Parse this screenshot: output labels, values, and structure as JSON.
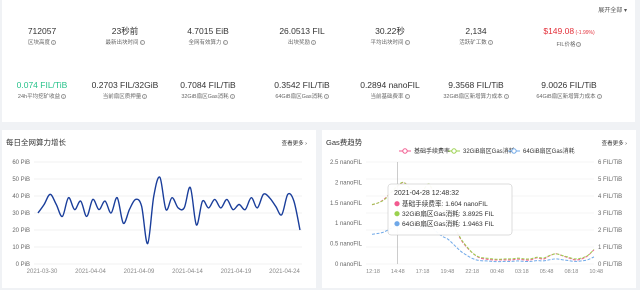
{
  "expand_label": "展开全部",
  "row1": [
    {
      "value": "712057",
      "label": "区块高度"
    },
    {
      "value": "23秒前",
      "label": "最新出块时间"
    },
    {
      "value": "4.7015 EiB",
      "label": "全网有效算力"
    },
    {
      "value": "26.0513 FIL",
      "label": "出块奖励"
    },
    {
      "value": "30.22秒",
      "label": "平均出块时间"
    },
    {
      "value": "2,134",
      "label": "活跃矿工数"
    },
    {
      "value": "$149.08",
      "change": "(-1.99%)",
      "label": "FIL价格"
    }
  ],
  "row2": [
    {
      "value": "0.074 FIL/TiB",
      "label": "24h平均挖矿收益"
    },
    {
      "value": "0.2703 FIL/32GiB",
      "label": "当前扇区质押量"
    },
    {
      "value": "0.7084 FIL/TiB",
      "label": "32GiB扇区Gas消耗"
    },
    {
      "value": "0.3542 FIL/TiB",
      "label": "64GiB扇区Gas消耗"
    },
    {
      "value": "0.2894 nanoFIL",
      "label": "当前基础费率"
    },
    {
      "value": "9.3568 FIL/TiB",
      "label": "32GiB扇区新增算力成本"
    },
    {
      "value": "9.0026 FIL/TiB",
      "label": "64GiB扇区新增算力成本"
    }
  ],
  "colors": {
    "green": "#27c28a",
    "red": "#e3303a",
    "navy": "#1a3e9b",
    "pink": "#f25a8f",
    "lime": "#9bd14f",
    "blue": "#6fa8e8"
  },
  "left_panel": {
    "title": "每日全网算力增长",
    "more": "查看更多 ›"
  },
  "right_panel": {
    "title": "Gas费趋势",
    "more": "查看更多 ›"
  },
  "chart_data": [
    {
      "type": "line",
      "title": "每日全网算力增长",
      "y_ticks": [
        "0 PiB",
        "10 PiB",
        "20 PiB",
        "30 PiB",
        "40 PiB",
        "50 PiB",
        "60 PiB"
      ],
      "x_ticks": [
        "2021-03-30",
        "2021-04-04",
        "2021-04-09",
        "2021-04-14",
        "2021-04-19",
        "2021-04-24"
      ],
      "ylim": [
        0,
        60
      ],
      "grid": true,
      "series": [
        {
          "values": [
            30,
            35,
            41,
            35,
            28,
            39,
            32,
            37,
            28,
            38,
            32,
            37,
            30,
            39,
            24,
            32,
            38,
            34,
            12,
            40,
            51,
            32,
            39,
            33,
            33,
            45,
            23,
            37,
            33,
            38,
            33,
            38,
            32,
            35,
            32,
            39,
            33,
            41,
            39,
            34,
            29,
            41,
            37,
            20
          ]
        }
      ]
    },
    {
      "type": "line",
      "title": "Gas费趋势",
      "legend": [
        "基础手续费率",
        "32GiB扇区Gas消耗",
        "64GiB扇区Gas消耗"
      ],
      "legend_position": "top",
      "y_left_ticks": [
        "0 nanoFIL",
        "0.5 nanoFIL",
        "1 nanoFIL",
        "1.5 nanoFIL",
        "2 nanoFIL",
        "2.5 nanoFIL"
      ],
      "y_right_ticks": [
        "0 FIL/TiB",
        "1 FIL/TiB",
        "2 FIL/TiB",
        "3 FIL/TiB",
        "4 FIL/TiB",
        "5 FIL/TiB",
        "6 FIL/TiB"
      ],
      "x_ticks": [
        "12:18",
        "14:48",
        "17:18",
        "19:48",
        "22:18",
        "00:48",
        "03:18",
        "05:48",
        "08:18",
        "10:48"
      ],
      "ylim_left": [
        0,
        2.5
      ],
      "ylim_right": [
        0,
        6
      ],
      "series": [
        {
          "name": "基础手续费率",
          "values": [
            1.45,
            1.5,
            1.6,
            1.75,
            1.9,
            2.0,
            1.85,
            1.7,
            1.8,
            1.95,
            1.6,
            1.4,
            1.2,
            0.9,
            0.6,
            0.4,
            0.25,
            0.15,
            0.12,
            0.1,
            0.1,
            0.1,
            0.1,
            0.12,
            0.1,
            0.1,
            0.15,
            0.12,
            0.2,
            0.25,
            0.2,
            0.15,
            0.1,
            0.12,
            0.2,
            0.35
          ]
        },
        {
          "name": "32GiB扇区Gas消耗",
          "values": [
            3.5,
            3.6,
            3.8,
            4.2,
            4.6,
            4.8,
            4.4,
            4.1,
            4.3,
            4.7,
            3.9,
            3.3,
            2.9,
            2.2,
            1.5,
            1.0,
            0.6,
            0.4,
            0.35,
            0.3,
            0.28,
            0.3,
            0.3,
            0.35,
            0.3,
            0.3,
            0.4,
            0.35,
            0.5,
            0.6,
            0.5,
            0.4,
            0.3,
            0.35,
            0.5,
            0.85
          ]
        },
        {
          "name": "64GiB扇区Gas消耗",
          "values": [
            1.75,
            1.8,
            1.9,
            2.1,
            2.3,
            2.4,
            2.2,
            2.05,
            2.15,
            2.35,
            1.95,
            1.65,
            1.45,
            1.1,
            0.75,
            0.5,
            0.3,
            0.2,
            0.18,
            0.15,
            0.14,
            0.15,
            0.15,
            0.18,
            0.15,
            0.15,
            0.2,
            0.18,
            0.25,
            0.3,
            0.25,
            0.2,
            0.15,
            0.18,
            0.25,
            0.42
          ]
        }
      ],
      "tooltip": {
        "time": "2021-04-28 12:48:32",
        "rows": [
          {
            "label": "基础手续费率",
            "value": "1.604 nanoFIL"
          },
          {
            "label": "32GiB扇区Gas消耗",
            "value": "3.8925 FIL"
          },
          {
            "label": "64GiB扇区Gas消耗",
            "value": "1.9463 FIL"
          }
        ]
      }
    }
  ]
}
